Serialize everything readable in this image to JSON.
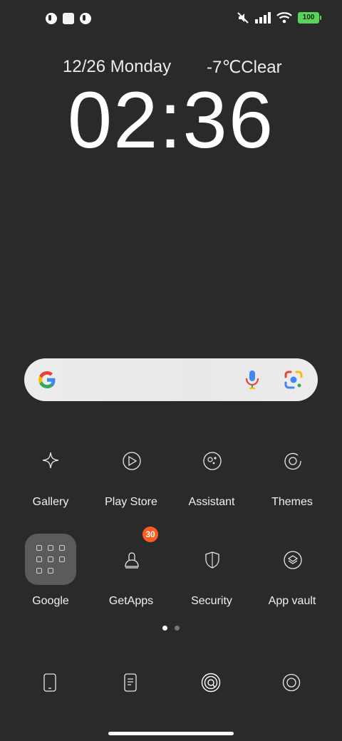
{
  "status_bar": {
    "battery_level": "100",
    "colors": {
      "battery": "#58d35b",
      "badge": "#ff5a1f"
    }
  },
  "lockscreen": {
    "date": "12/26 Monday",
    "weather": "-7℃Clear",
    "time": "02:36"
  },
  "search_bar": {
    "logo": "google-g-icon",
    "mic": "mic-icon",
    "lens": "lens-icon"
  },
  "apps": [
    {
      "label": "Gallery",
      "icon": "sparkle-icon"
    },
    {
      "label": "Play Store",
      "icon": "play-icon"
    },
    {
      "label": "Assistant",
      "icon": "assistant-icon"
    },
    {
      "label": "Themes",
      "icon": "themes-icon"
    },
    {
      "label": "Google",
      "icon": "folder-icon"
    },
    {
      "label": "GetApps",
      "icon": "bag-icon",
      "badge": "30"
    },
    {
      "label": "Security",
      "icon": "shield-icon"
    },
    {
      "label": "App vault",
      "icon": "vault-icon"
    }
  ],
  "pages": {
    "count": 2,
    "active": 1
  },
  "dock": [
    {
      "icon": "phone-icon"
    },
    {
      "icon": "messages-icon"
    },
    {
      "icon": "browser-icon"
    },
    {
      "icon": "camera-icon"
    }
  ]
}
